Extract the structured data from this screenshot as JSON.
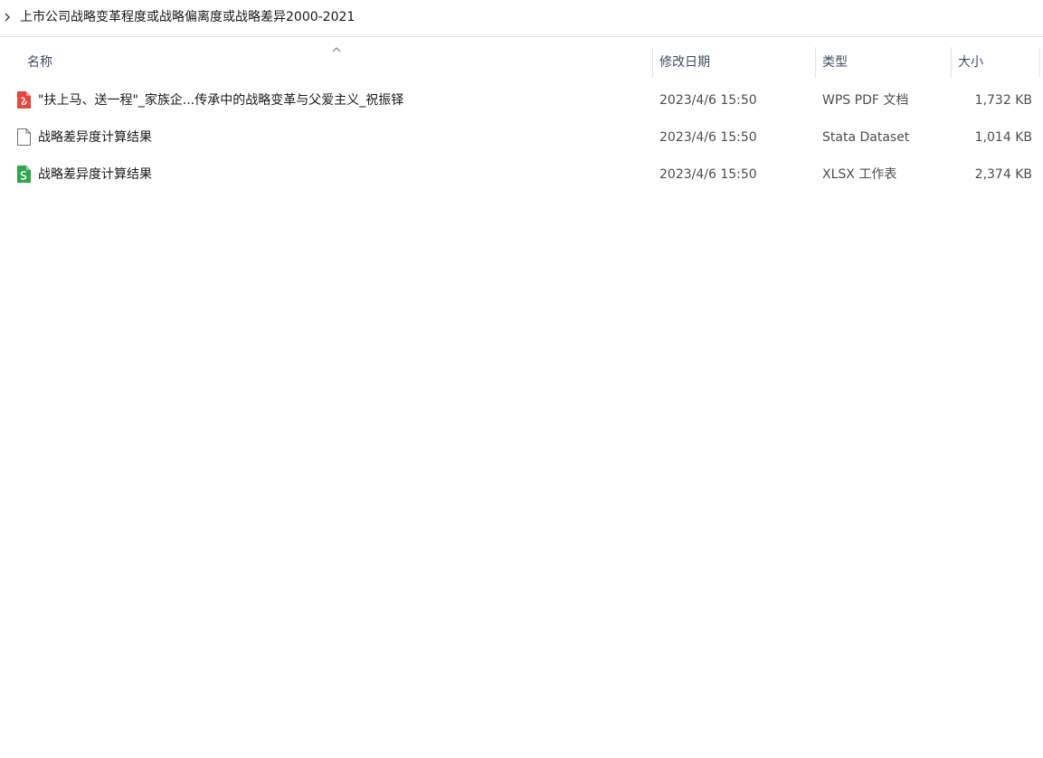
{
  "breadcrumb": {
    "chevron_icon": "chevron-right-icon",
    "path": "上市公司战略变革程度或战略偏离度或战略差异2000-2021"
  },
  "columns": {
    "name": "名称",
    "date": "修改日期",
    "type": "类型",
    "size": "大小",
    "sort_icon": "sort-ascending-caret-icon"
  },
  "files": [
    {
      "icon": "pdf-file-icon",
      "name": "\"扶上马、送一程\"_家族企...传承中的战略变革与父爱主义_祝振铎",
      "date": "2023/4/6 15:50",
      "type": "WPS PDF 文档",
      "size": "1,732 KB"
    },
    {
      "icon": "blank-file-icon",
      "name": "战略差异度计算结果",
      "date": "2023/4/6 15:50",
      "type": "Stata Dataset",
      "size": "1,014 KB"
    },
    {
      "icon": "spreadsheet-file-icon",
      "name": "战略差异度计算结果",
      "date": "2023/4/6 15:50",
      "type": "XLSX 工作表",
      "size": "2,374 KB"
    }
  ],
  "colors": {
    "pdf_icon": "#e8453c",
    "xlsx_icon": "#2ca84a",
    "header_text": "#3d4c66",
    "divider": "#e5e5e5"
  }
}
